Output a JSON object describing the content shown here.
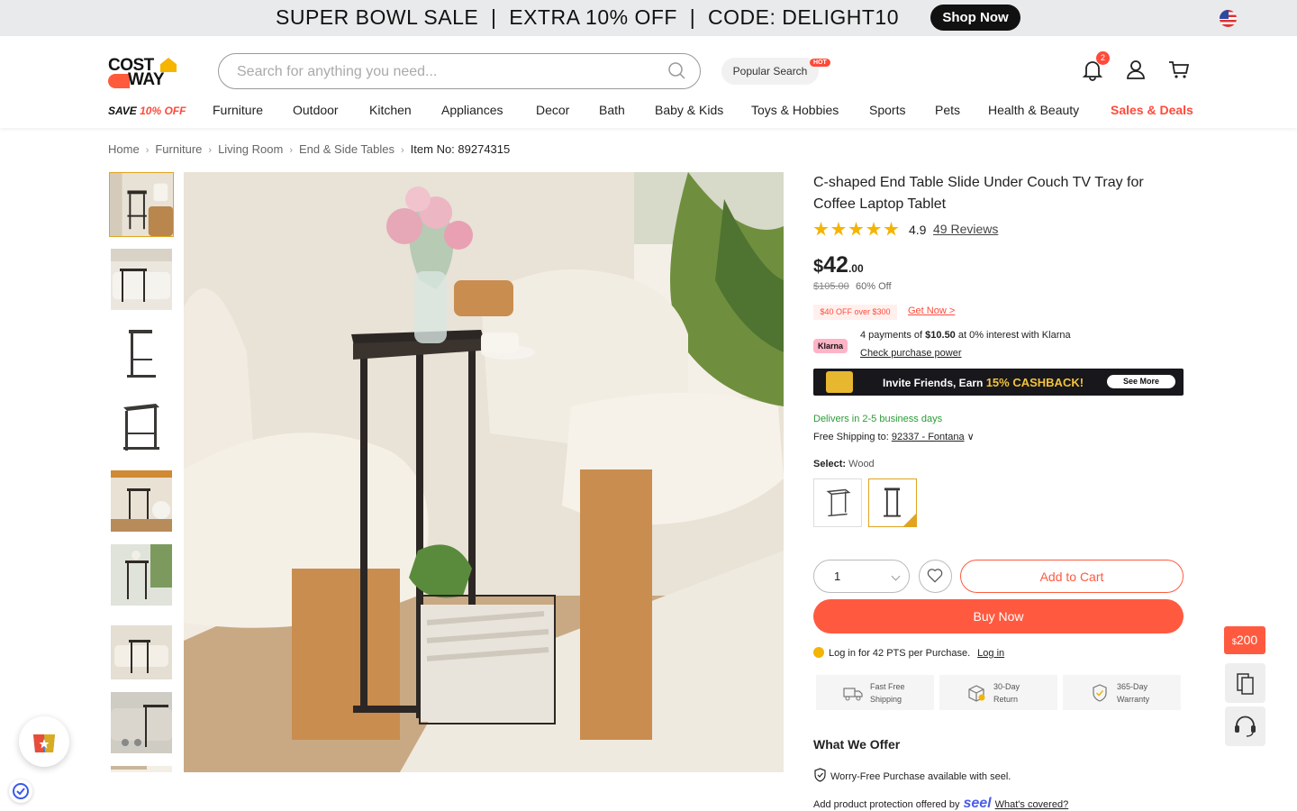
{
  "promo": {
    "text": "SUPER BOWL SALE  |  EXTRA 10% OFF  |  CODE: DELIGHT10",
    "button": "Shop Now"
  },
  "header": {
    "logo_line1": "COST",
    "logo_line2": "WAY",
    "search_placeholder": "Search for anything you need...",
    "popular_search": "Popular Search",
    "hot_badge": "HOT",
    "notification_count": "2",
    "save_prefix": "SAVE ",
    "save_highlight": "10% OFF"
  },
  "nav": {
    "items": [
      "Furniture",
      "Outdoor",
      "Kitchen",
      "Appliances",
      "Decor",
      "Bath",
      "Baby & Kids",
      "Toys & Hobbies",
      "Sports",
      "Pets",
      "Health & Beauty",
      "Sales & Deals"
    ]
  },
  "breadcrumb": {
    "items": [
      "Home",
      "Furniture",
      "Living Room",
      "End & Side Tables"
    ],
    "current": "Item No: 89274315"
  },
  "product": {
    "title": "C-shaped End Table Slide Under Couch TV Tray for Coffee Laptop Tablet",
    "stars": 5,
    "rating": "4.9",
    "reviews": "49 Reviews",
    "price_currency": "$",
    "price_whole": "42",
    "price_cents": ".00",
    "was_price": "$105.00",
    "discount": "60% Off",
    "coupon": "$40 OFF over $300",
    "get_now": "Get Now >",
    "klarna_logo": "Klarna",
    "klarna_prefix": "4 payments of ",
    "klarna_amount": "$10.50",
    "klarna_suffix": " at 0% interest with Klarna",
    "klarna_link": "Check purchase power",
    "cashback_prefix": "Invite Friends, Earn ",
    "cashback_highlight": "15% CASHBACK!",
    "cashback_button": "See More",
    "delivery": "Delivers in 2-5 business days",
    "shipping_prefix": "Free Shipping to: ",
    "shipping_zip": "92337 - Fontana",
    "select_label": "Select:",
    "select_value": "Wood",
    "quantity": "1",
    "add_to_cart": "Add to Cart",
    "buy_now": "Buy Now",
    "points_text": "Log in for 42 PTS per Purchase.",
    "login_link": "Log in",
    "perks": [
      {
        "line1": "Fast Free",
        "line2": "Shipping"
      },
      {
        "line1": "30-Day",
        "line2": "Return"
      },
      {
        "line1": "365-Day",
        "line2": "Warranty"
      }
    ],
    "offer_title": "What We Offer",
    "worry_free": "Worry-Free Purchase available with seel.",
    "protection_prefix": "Add product protection offered by",
    "seel_logo": "seel",
    "whats_covered": "What's covered?"
  },
  "side": {
    "reward_currency": "$",
    "reward_amount": "200"
  },
  "colors": {
    "accent": "#ff5a40",
    "selected_border": "#e0a420",
    "delivery_green": "#2c9a36",
    "star": "#f4b400"
  }
}
